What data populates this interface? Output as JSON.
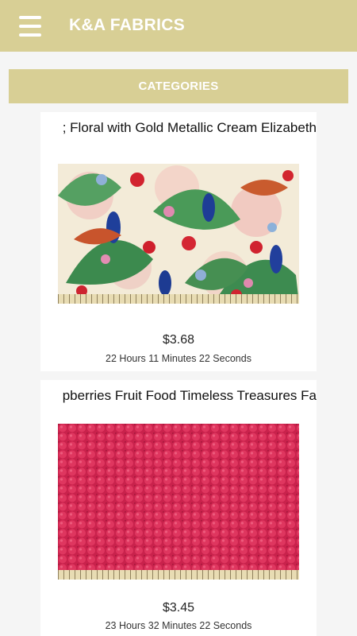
{
  "header": {
    "title": "K&A FABRICS",
    "menu_icon": "hamburger-menu-icon",
    "background": "#d8cf95"
  },
  "categories_label": "CATEGORIES",
  "products": [
    {
      "title": "; Floral with Gold Metallic Cream Elizabeth",
      "price": "$3.68",
      "time_left": "22 Hours 11 Minutes 22 Seconds",
      "image": "peacock-floral-fabric-image"
    },
    {
      "title": "pberries Fruit Food Timeless Treasures Fa",
      "price": "$3.45",
      "time_left": "23 Hours 32 Minutes 22 Seconds",
      "image": "raspberry-fabric-image"
    }
  ]
}
